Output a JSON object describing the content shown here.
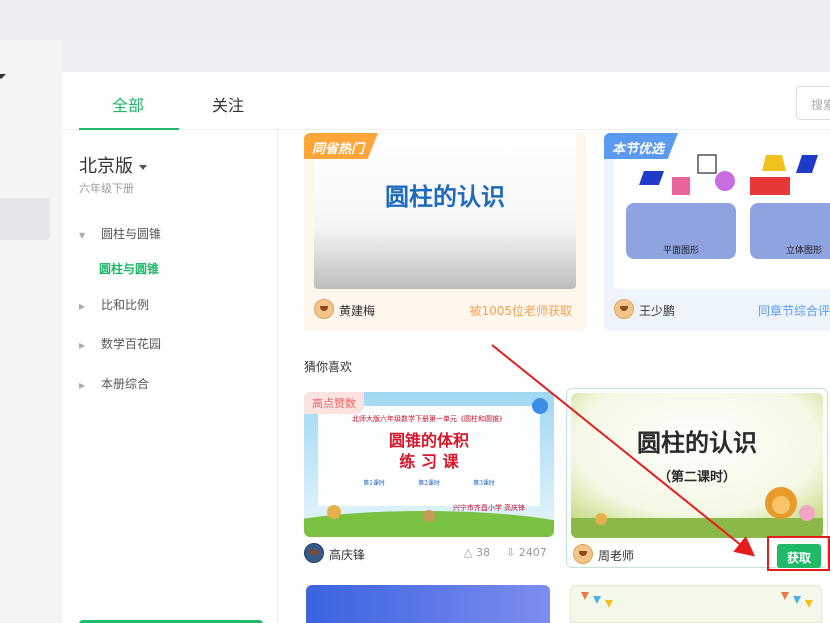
{
  "tabs": {
    "all": "全部",
    "follow": "关注"
  },
  "search": {
    "placeholder": "搜索"
  },
  "sidebar": {
    "edition": "北京版",
    "grade": "六年级下册",
    "items": [
      {
        "label": "圆柱与圆锥",
        "expanded": true
      },
      {
        "label": "比和比例",
        "expanded": false
      },
      {
        "label": "数学百花园",
        "expanded": false
      },
      {
        "label": "本册综合",
        "expanded": false
      }
    ],
    "active_sub": "圆柱与圆锥"
  },
  "featured": [
    {
      "ribbon": "同省热门",
      "title": "圆柱的认识",
      "author": "黄建梅",
      "note": "被1005位老师获取",
      "ribbon_color": "#ffa63a"
    },
    {
      "ribbon": "本节优选",
      "author": "王少鹏",
      "note": "同章节综合评分",
      "thumb_labels": [
        "平面图形",
        "立体图形"
      ],
      "ribbon_color": "#5a9bf0"
    }
  ],
  "guess": {
    "title": "猜你喜欢",
    "cards": [
      {
        "badge": "高点赞数",
        "thumb_header": "北师大版六年级数学下册第一单元《圆柱和圆锥》",
        "thumb_title_1": "圆锥的体积",
        "thumb_title_2": "练 习 课",
        "thumb_slot_1": "第1课时",
        "thumb_slot_2": "第2课时",
        "thumb_slot_3": "第3课时",
        "thumb_footer": "兴宁市齐昌小学 高庆锋",
        "author": "高庆锋",
        "likes": "38",
        "downloads": "2407"
      },
      {
        "thumb_title": "圆柱的认识",
        "thumb_subtitle": "（第二课时）",
        "author": "周老师",
        "action": "获取"
      }
    ]
  },
  "icons": [
    "like-icon",
    "download-icon",
    "chevron-down-icon",
    "caret-right-icon"
  ],
  "colors": {
    "accent": "#20b968",
    "highlight": "#e51c1c"
  }
}
